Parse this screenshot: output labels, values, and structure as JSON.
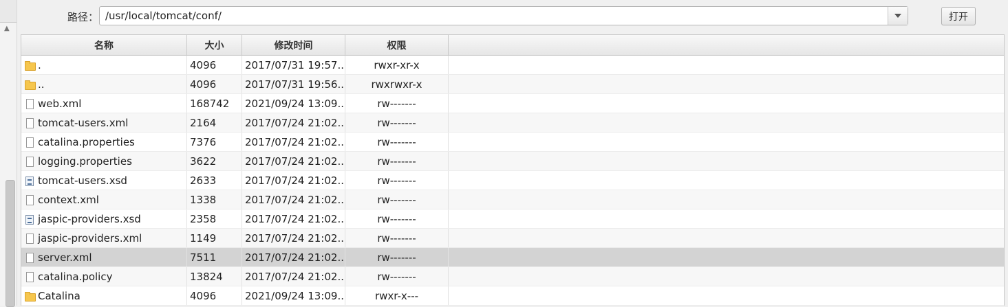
{
  "path_bar": {
    "label": "路径：",
    "value": "/usr/local/tomcat/conf/",
    "open_button": "打开"
  },
  "table": {
    "columns": {
      "name": "名称",
      "size": "大小",
      "modified": "修改时间",
      "permissions": "权限"
    },
    "rows": [
      {
        "icon": "folder-icon",
        "name": ".",
        "size": "4096",
        "modified": "2017/07/31 19:57...",
        "permissions": "rwxr-xr-x",
        "selected": false
      },
      {
        "icon": "folder-icon",
        "name": "..",
        "size": "4096",
        "modified": "2017/07/31 19:56...",
        "permissions": "rwxrwxr-x",
        "selected": false
      },
      {
        "icon": "file-icon",
        "name": "web.xml",
        "size": "168742",
        "modified": "2021/09/24 13:09...",
        "permissions": "rw-------",
        "selected": false
      },
      {
        "icon": "file-icon",
        "name": "tomcat-users.xml",
        "size": "2164",
        "modified": "2017/07/24 21:02...",
        "permissions": "rw-------",
        "selected": false
      },
      {
        "icon": "file-icon",
        "name": "catalina.properties",
        "size": "7376",
        "modified": "2017/07/24 21:02...",
        "permissions": "rw-------",
        "selected": false
      },
      {
        "icon": "file-icon",
        "name": "logging.properties",
        "size": "3622",
        "modified": "2017/07/24 21:02...",
        "permissions": "rw-------",
        "selected": false
      },
      {
        "icon": "schema-file-icon",
        "name": "tomcat-users.xsd",
        "size": "2633",
        "modified": "2017/07/24 21:02...",
        "permissions": "rw-------",
        "selected": false
      },
      {
        "icon": "file-icon",
        "name": "context.xml",
        "size": "1338",
        "modified": "2017/07/24 21:02...",
        "permissions": "rw-------",
        "selected": false
      },
      {
        "icon": "schema-file-icon",
        "name": "jaspic-providers.xsd",
        "size": "2358",
        "modified": "2017/07/24 21:02...",
        "permissions": "rw-------",
        "selected": false
      },
      {
        "icon": "file-icon",
        "name": "jaspic-providers.xml",
        "size": "1149",
        "modified": "2017/07/24 21:02...",
        "permissions": "rw-------",
        "selected": false
      },
      {
        "icon": "file-icon",
        "name": "server.xml",
        "size": "7511",
        "modified": "2017/07/24 21:02...",
        "permissions": "rw-------",
        "selected": true
      },
      {
        "icon": "file-icon",
        "name": "catalina.policy",
        "size": "13824",
        "modified": "2017/07/24 21:02...",
        "permissions": "rw-------",
        "selected": false
      },
      {
        "icon": "folder-icon",
        "name": "Catalina",
        "size": "4096",
        "modified": "2021/09/24 13:09...",
        "permissions": "rwxr-x---",
        "selected": false
      }
    ]
  },
  "colors": {
    "selected_row": "#d3d3d3",
    "folder": "#f6c64d"
  }
}
